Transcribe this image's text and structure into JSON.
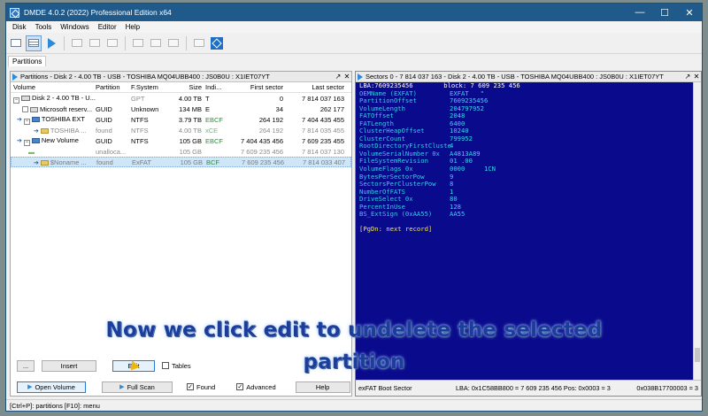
{
  "window": {
    "title": "DMDE 4.0.2 (2022) Professional Edition x64",
    "min_glyph": "—",
    "max_glyph": "☐",
    "close_glyph": "✕"
  },
  "menu": [
    "Disk",
    "Tools",
    "Windows",
    "Editor",
    "Help"
  ],
  "tab": "Partitions",
  "partitions_panel": {
    "title": "Partitions - Disk 2 - 4.00 TB - USB - TOSHIBA MQ04UBB400 : JS0B0U : X1IET07YT",
    "columns": [
      "Volume",
      "Partition",
      "F.System",
      "Size",
      "Indi...",
      "First sector",
      "Last sector"
    ],
    "rows": [
      {
        "volume": "Disk 2 - 4.00 TB - U...",
        "partition": "",
        "fs": "GPT",
        "size": "4.00 TB",
        "ind": "T",
        "first": "0",
        "last": "7 814 037 163"
      },
      {
        "volume": "Microsoft reserv...",
        "partition": "GUID",
        "fs": "Unknown",
        "size": "134 MB",
        "ind": "E",
        "first": "34",
        "last": "262 177"
      },
      {
        "volume": "TOSHIBA EXT",
        "partition": "GUID",
        "fs": "NTFS",
        "size": "3.79 TB",
        "ind": "EBCF",
        "first": "264 192",
        "last": "7 404 435 455"
      },
      {
        "volume": "TOSHIBA ...",
        "partition": "found",
        "fs": "NTFS",
        "size": "4.00 TB",
        "ind": "xCE",
        "first": "264 192",
        "last": "7 814 035 455"
      },
      {
        "volume": "New Volume",
        "partition": "GUID",
        "fs": "NTFS",
        "size": "105 GB",
        "ind": "EBCF",
        "first": "7 404 435 456",
        "last": "7 609 235 455"
      },
      {
        "volume": "",
        "partition": "unalloca...",
        "fs": "",
        "size": "105 GB",
        "ind": "",
        "first": "7 609 235 456",
        "last": "7 814 037 130"
      },
      {
        "volume": "$Noname ...",
        "partition": "found",
        "fs": "ExFAT",
        "size": "105 GB",
        "ind": "BCF",
        "first": "7 609 235 456",
        "last": "7 814 033 407"
      }
    ],
    "buttons": {
      "more": "...",
      "insert": "Insert",
      "edit": "Edit",
      "tables": "Tables",
      "open_volume": "Open Volume",
      "full_scan": "Full Scan",
      "found": "Found",
      "advanced": "Advanced",
      "help": "Help"
    }
  },
  "sectors_panel": {
    "title": "Sectors 0 - 7 814 037 163 - Disk 2 - 4.00 TB - USB - TOSHIBA MQ04UBB400 : JS0B0U : X1IET07YT",
    "top_line": "LBA:7609235456        block: 7 609 235 456",
    "fields": [
      {
        "k": "OEMName (EXFAT)",
        "v": "EXFAT   \""
      },
      {
        "k": "PartitionOffset",
        "v": "7609235456"
      },
      {
        "k": "VolumeLength",
        "v": "204797952"
      },
      {
        "k": "FATOffset",
        "v": "2048"
      },
      {
        "k": "FATLength",
        "v": "6400"
      },
      {
        "k": "ClusterHeapOffset",
        "v": "10240"
      },
      {
        "k": "ClusterCount",
        "v": "799952"
      },
      {
        "k": "RootDirectoryFirstCluste",
        "v": "4"
      },
      {
        "k": "VolumeSerialNumber 0x",
        "v": "A4813A89"
      },
      {
        "k": "FileSystemRevision",
        "v": "01 .00"
      },
      {
        "k": "VolumeFlags 0x",
        "v": "0000     1CN"
      },
      {
        "k": "BytesPerSectorPow",
        "v": "9"
      },
      {
        "k": "SectorsPerClusterPow",
        "v": "8"
      },
      {
        "k": "NumberOfFATS",
        "v": "1"
      },
      {
        "k": "DriveSelect 0x",
        "v": "80"
      },
      {
        "k": "PercentInUse",
        "v": "128"
      },
      {
        "k": "BS_ExtSign (0xAA55)",
        "v": "AA55"
      }
    ],
    "pgdn": "[PgDn: next record]",
    "status": {
      "type": "exFAT Boot Sector",
      "lba": "LBA: 0x1C58BB800 = 7 609 235 456 Pos: 0x0003 = 3",
      "hex": "0x038B17700003 = 3"
    }
  },
  "status_bar": "[Ctrl+P]: partitions  [F10]: menu",
  "caption": {
    "line1": "Now we click edit to undelete the selected",
    "line2": "partition"
  }
}
